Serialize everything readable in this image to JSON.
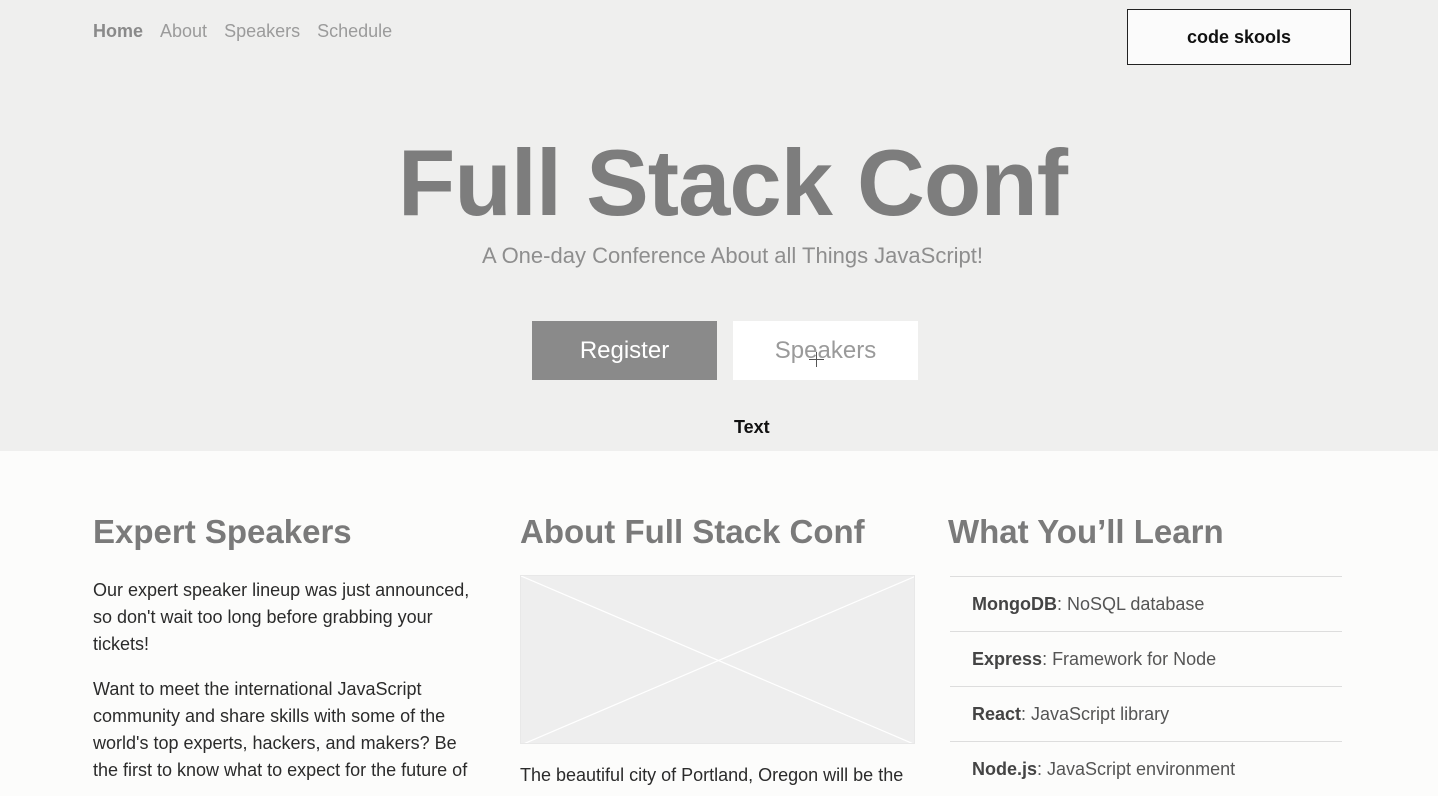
{
  "nav": {
    "items": [
      "Home",
      "About",
      "Speakers",
      "Schedule"
    ],
    "active": "Home"
  },
  "brand": "code skools",
  "hero": {
    "title": "Full Stack Conf",
    "subtitle": "A One-day Conference About all Things JavaScript!",
    "register_label": "Register",
    "speakers_label": "Speakers",
    "text_label": "Text"
  },
  "columns": {
    "speakers": {
      "heading": "Expert Speakers",
      "p1": "Our expert speaker lineup was just announced, so don't wait too long before grabbing your tickets!",
      "p2": "Want to meet the international JavaScript community and share skills with some of the world's top experts, hackers, and makers? Be the first to know what to expect for the future of"
    },
    "about": {
      "heading": "About Full Stack Conf",
      "p1": "The beautiful city of Portland, Oregon will be the"
    },
    "learn": {
      "heading": "What You’ll Learn",
      "items": [
        {
          "name": "MongoDB",
          "desc": ": NoSQL database"
        },
        {
          "name": "Express",
          "desc": ": Framework for Node"
        },
        {
          "name": "React",
          "desc": ": JavaScript library"
        },
        {
          "name": "Node.js",
          "desc": ": JavaScript environment"
        }
      ]
    }
  },
  "colors": {
    "hero_bg": "#efefee",
    "page_bg": "#fcfcfb",
    "register_bg": "#8a8a8a",
    "heading": "#7a7a7a"
  }
}
